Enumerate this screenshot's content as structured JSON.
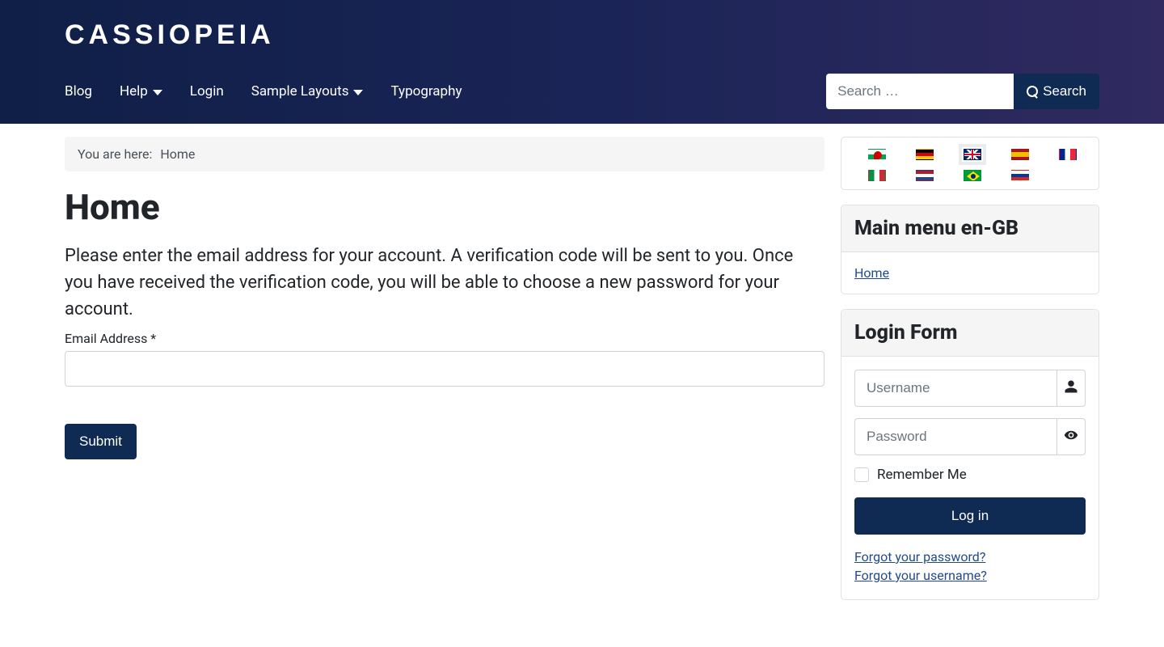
{
  "brand": "CASSIOPEIA",
  "nav": {
    "blog": "Blog",
    "help": "Help",
    "login": "Login",
    "sample_layouts": "Sample Layouts",
    "typography": "Typography"
  },
  "search": {
    "placeholder": "Search …",
    "button": "Search"
  },
  "breadcrumb": {
    "label": "You are here:",
    "home": "Home"
  },
  "page": {
    "title": "Home",
    "lead": "Please enter the email address for your account. A verification code will be sent to you. Once you have received the verification code, you will be able to choose a new password for your account.",
    "email_label": "Email Address *",
    "submit": "Submit"
  },
  "sidebar": {
    "menu_title": "Main menu en-GB",
    "menu_home": "Home",
    "login_form_title": "Login Form",
    "username_placeholder": "Username",
    "password_placeholder": "Password",
    "remember": "Remember Me",
    "login_button": "Log in",
    "forgot_password": "Forgot your password?",
    "forgot_username": "Forgot your username?"
  },
  "flags": {
    "wales": "Welsh",
    "germany": "German",
    "uk": "English (UK)",
    "spain": "Spanish",
    "france": "French",
    "italy": "Italian",
    "netherlands": "Dutch",
    "brazil": "Portuguese (Brazil)",
    "russia": "Russian"
  }
}
